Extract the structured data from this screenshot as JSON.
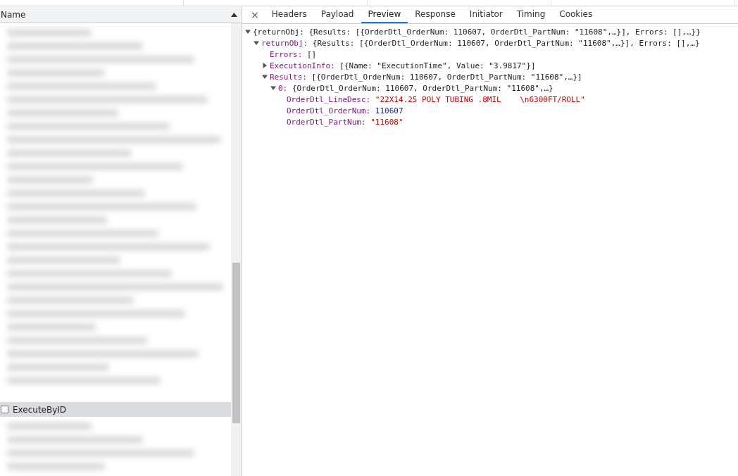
{
  "requests": {
    "header": "Name",
    "selected_row": {
      "name": "ExecuteByID",
      "checked": false,
      "selected": true
    }
  },
  "details": {
    "close": "×",
    "tabs": [
      {
        "label": "Headers",
        "selected": false
      },
      {
        "label": "Payload",
        "selected": false
      },
      {
        "label": "Preview",
        "selected": true
      },
      {
        "label": "Response",
        "selected": false
      },
      {
        "label": "Initiator",
        "selected": false
      },
      {
        "label": "Timing",
        "selected": false
      },
      {
        "label": "Cookies",
        "selected": false
      }
    ],
    "preview": [
      {
        "kind": "root",
        "text": "{returnObj: {Results: [{OrderDtl_OrderNum: 110607, OrderDtl_PartNum: \"11608\",…}], Errors: [],…}}",
        "expanded": true,
        "children": [
          {
            "kind": "summary",
            "key": "returnObj:",
            "value": "{Results: [{OrderDtl_OrderNum: 110607, OrderDtl_PartNum: \"11608\",…}], Errors: [],…}",
            "expanded": true,
            "children": [
              {
                "kind": "summary",
                "key": "Errors:",
                "value": "[]"
              },
              {
                "kind": "summary",
                "key": "ExecutionInfo:",
                "value": "[{Name: \"ExecutionTime\", Value: \"3.9817\"}]",
                "expanded": false
              },
              {
                "kind": "summary",
                "key": "Results:",
                "value": "[{OrderDtl_OrderNum: 110607, OrderDtl_PartNum: \"11608\",…}]",
                "expanded": true,
                "children": [
                  {
                    "kind": "summary",
                    "key": "0:",
                    "value": "{OrderDtl_OrderNum: 110607, OrderDtl_PartNum: \"11608\",…}",
                    "expanded": true,
                    "children": [
                      {
                        "kind": "string",
                        "key": "OrderDtl_LineDesc:",
                        "value": "\"22X14.25 POLY TUBING .8MIL    \\n6300FT/ROLL\""
                      },
                      {
                        "kind": "number",
                        "key": "OrderDtl_OrderNum:",
                        "value": "110607"
                      },
                      {
                        "kind": "string",
                        "key": "OrderDtl_PartNum:",
                        "value": "\"11608\""
                      }
                    ]
                  }
                ]
              }
            ]
          }
        ]
      }
    ]
  }
}
